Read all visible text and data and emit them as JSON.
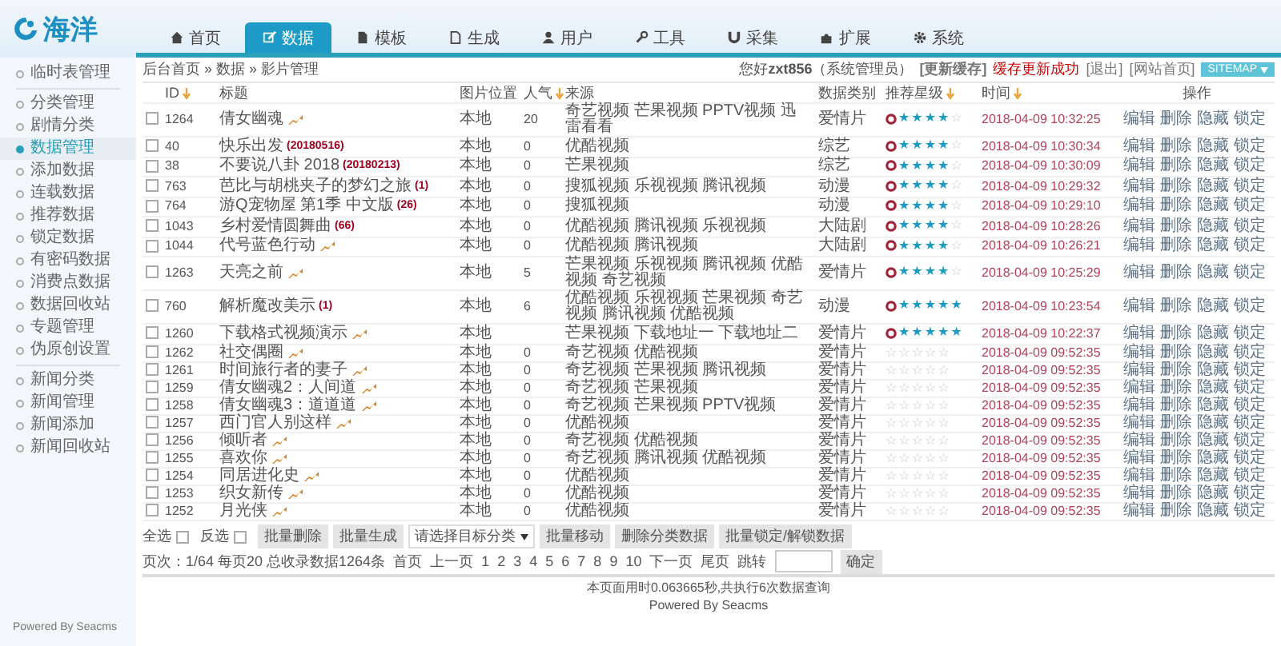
{
  "logo": {
    "text": "海洋"
  },
  "nav": [
    {
      "label": "首页",
      "selected": false
    },
    {
      "label": "数据",
      "selected": true
    },
    {
      "label": "模板",
      "selected": false
    },
    {
      "label": "生成",
      "selected": false
    },
    {
      "label": "用户",
      "selected": false
    },
    {
      "label": "工具",
      "selected": false
    },
    {
      "label": "采集",
      "selected": false
    },
    {
      "label": "扩展",
      "selected": false
    },
    {
      "label": "系统",
      "selected": false
    }
  ],
  "breadcrumb": "后台首页 » 数据 » 影片管理",
  "user_bar": {
    "greeting": "您好",
    "user": "zxt856",
    "role": "（系统管理员）",
    "refresh": "[更新缓存]",
    "status": "缓存更新成功",
    "logout": "[退出]",
    "home": "[网站首页]",
    "sitemap": "SITEMAP"
  },
  "sidebar": {
    "groups": [
      [
        {
          "label": "临时表管理",
          "selected": false
        }
      ],
      [
        {
          "label": "分类管理",
          "selected": false
        },
        {
          "label": "剧情分类",
          "selected": false
        },
        {
          "label": "数据管理",
          "selected": true
        },
        {
          "label": "添加数据",
          "selected": false
        },
        {
          "label": "连载数据",
          "selected": false
        },
        {
          "label": "推荐数据",
          "selected": false
        },
        {
          "label": "锁定数据",
          "selected": false
        },
        {
          "label": "有密码数据",
          "selected": false
        },
        {
          "label": "消费点数据",
          "selected": false
        },
        {
          "label": "数据回收站",
          "selected": false
        },
        {
          "label": "专题管理",
          "selected": false
        },
        {
          "label": "伪原创设置",
          "selected": false
        }
      ],
      [
        {
          "label": "新闻分类",
          "selected": false
        },
        {
          "label": "新闻管理",
          "selected": false
        },
        {
          "label": "新闻添加",
          "selected": false
        },
        {
          "label": "新闻回收站",
          "selected": false
        }
      ]
    ],
    "footer": "Powered By Seacms"
  },
  "table": {
    "columns": [
      {
        "label": "ID",
        "sortable": true
      },
      {
        "label": "标题",
        "sortable": false
      },
      {
        "label": "图片位置",
        "sortable": false
      },
      {
        "label": "人气",
        "sortable": true
      },
      {
        "label": "来源",
        "sortable": false
      },
      {
        "label": "数据类别",
        "sortable": false
      },
      {
        "label": "推荐星级",
        "sortable": true
      },
      {
        "label": "时间",
        "sortable": true
      },
      {
        "label": "操作",
        "sortable": false
      }
    ],
    "rows": [
      {
        "checked": false,
        "id": "1264",
        "title": "倩女幽魂",
        "hot": true,
        "image": "本地",
        "popularity": "20",
        "source": "奇艺视频 芒果视频 PPTV视频 迅雷看看",
        "category": "爱情片",
        "stars": 4,
        "time": "2018-04-09 10:32:25",
        "actions": [
          "编辑",
          "删除",
          "隐藏",
          "锁定"
        ]
      },
      {
        "checked": false,
        "id": "40",
        "title": "快乐出发",
        "note": "(20180516)",
        "hot": false,
        "image": "本地",
        "popularity": "0",
        "source": "优酷视频",
        "category": "综艺",
        "stars": 4,
        "time": "2018-04-09 10:30:34",
        "actions": [
          "编辑",
          "删除",
          "隐藏",
          "锁定"
        ]
      },
      {
        "checked": false,
        "id": "38",
        "title": "不要说八卦 2018",
        "note": "(20180213)",
        "hot": false,
        "image": "本地",
        "popularity": "0",
        "source": "芒果视频",
        "category": "综艺",
        "stars": 4,
        "time": "2018-04-09 10:30:09",
        "actions": [
          "编辑",
          "删除",
          "隐藏",
          "锁定"
        ]
      },
      {
        "checked": false,
        "id": "763",
        "title": "芭比与胡桃夹子的梦幻之旅",
        "note": "(1)",
        "hot": false,
        "image": "本地",
        "popularity": "0",
        "source": "搜狐视频 乐视视频 腾讯视频",
        "category": "动漫",
        "stars": 4,
        "time": "2018-04-09 10:29:32",
        "actions": [
          "编辑",
          "删除",
          "隐藏",
          "锁定"
        ]
      },
      {
        "checked": false,
        "id": "764",
        "title": "游Q宠物屋 第1季 中文版",
        "note": "(26)",
        "hot": false,
        "image": "本地",
        "popularity": "0",
        "source": "搜狐视频",
        "category": "动漫",
        "stars": 4,
        "time": "2018-04-09 10:29:10",
        "actions": [
          "编辑",
          "删除",
          "隐藏",
          "锁定"
        ]
      },
      {
        "checked": false,
        "id": "1043",
        "title": "乡村爱情圆舞曲",
        "note": "(66)",
        "hot": false,
        "image": "本地",
        "popularity": "0",
        "source": "优酷视频 腾讯视频 乐视视频",
        "category": "大陆剧",
        "stars": 4,
        "time": "2018-04-09 10:28:26",
        "actions": [
          "编辑",
          "删除",
          "隐藏",
          "锁定"
        ]
      },
      {
        "checked": false,
        "id": "1044",
        "title": "代号蓝色行动",
        "hot": true,
        "image": "本地",
        "popularity": "0",
        "source": "优酷视频 腾讯视频",
        "category": "大陆剧",
        "stars": 4,
        "time": "2018-04-09 10:26:21",
        "actions": [
          "编辑",
          "删除",
          "隐藏",
          "锁定"
        ]
      },
      {
        "checked": false,
        "id": "1263",
        "title": "天亮之前",
        "hot": true,
        "image": "本地",
        "popularity": "5",
        "source": "芒果视频 乐视视频 腾讯视频 优酷视频 奇艺视频",
        "category": "爱情片",
        "stars": 4,
        "time": "2018-04-09 10:25:29",
        "actions": [
          "编辑",
          "删除",
          "隐藏",
          "锁定"
        ]
      },
      {
        "checked": false,
        "id": "760",
        "title": "解析魔改美示",
        "note": "(1)",
        "hot": false,
        "image": "本地",
        "popularity": "6",
        "source": "优酷视频 乐视视频 芒果视频 奇艺视频 腾讯视频 优酷视频",
        "category": "动漫",
        "stars": 5,
        "time": "2018-04-09 10:23:54",
        "actions": [
          "编辑",
          "删除",
          "隐藏",
          "锁定"
        ]
      },
      {
        "checked": false,
        "id": "1260",
        "title": "下载格式视频演示",
        "hot": true,
        "image": "本地",
        "source": "芒果视频 下载地址一 下载地址二",
        "category": "爱情片",
        "stars": 5,
        "time": "2018-04-09 10:22:37",
        "actions": [
          "编辑",
          "删除",
          "隐藏",
          "锁定"
        ]
      },
      {
        "checked": false,
        "id": "1262",
        "title": "社交偶圈",
        "hot": true,
        "image": "本地",
        "popularity": "0",
        "source": "奇艺视频 优酷视频",
        "category": "爱情片",
        "stars": 0,
        "time": "2018-04-09 09:52:35",
        "actions": [
          "编辑",
          "删除",
          "隐藏",
          "锁定"
        ]
      },
      {
        "checked": false,
        "id": "1261",
        "title": "时间旅行者的妻子",
        "hot": true,
        "image": "本地",
        "popularity": "0",
        "source": "奇艺视频 芒果视频 腾讯视频",
        "category": "爱情片",
        "stars": 0,
        "time": "2018-04-09 09:52:35",
        "actions": [
          "编辑",
          "删除",
          "隐藏",
          "锁定"
        ]
      },
      {
        "checked": false,
        "id": "1259",
        "title": "倩女幽魂2：人间道",
        "hot": true,
        "image": "本地",
        "popularity": "0",
        "source": "奇艺视频 芒果视频",
        "category": "爱情片",
        "stars": 0,
        "time": "2018-04-09 09:52:35",
        "actions": [
          "编辑",
          "删除",
          "隐藏",
          "锁定"
        ]
      },
      {
        "checked": false,
        "id": "1258",
        "title": "倩女幽魂3：道道道",
        "hot": true,
        "image": "本地",
        "popularity": "0",
        "source": "奇艺视频 芒果视频 PPTV视频",
        "category": "爱情片",
        "stars": 0,
        "time": "2018-04-09 09:52:35",
        "actions": [
          "编辑",
          "删除",
          "隐藏",
          "锁定"
        ]
      },
      {
        "checked": false,
        "id": "1257",
        "title": "西门官人别这样",
        "hot": true,
        "image": "本地",
        "popularity": "0",
        "source": "优酷视频",
        "category": "爱情片",
        "stars": 0,
        "time": "2018-04-09 09:52:35",
        "actions": [
          "编辑",
          "删除",
          "隐藏",
          "锁定"
        ]
      },
      {
        "checked": false,
        "id": "1256",
        "title": "倾听者",
        "hot": true,
        "image": "本地",
        "popularity": "0",
        "source": "奇艺视频 优酷视频",
        "category": "爱情片",
        "stars": 0,
        "time": "2018-04-09 09:52:35",
        "actions": [
          "编辑",
          "删除",
          "隐藏",
          "锁定"
        ]
      },
      {
        "checked": false,
        "id": "1255",
        "title": "喜欢你",
        "hot": true,
        "image": "本地",
        "popularity": "0",
        "source": "奇艺视频 腾讯视频 优酷视频",
        "category": "爱情片",
        "stars": 0,
        "time": "2018-04-09 09:52:35",
        "actions": [
          "编辑",
          "删除",
          "隐藏",
          "锁定"
        ]
      },
      {
        "checked": false,
        "id": "1254",
        "title": "同居进化史",
        "hot": true,
        "image": "本地",
        "popularity": "0",
        "source": "优酷视频",
        "category": "爱情片",
        "stars": 0,
        "time": "2018-04-09 09:52:35",
        "actions": [
          "编辑",
          "删除",
          "隐藏",
          "锁定"
        ]
      },
      {
        "checked": false,
        "id": "1253",
        "title": "织女新传",
        "hot": true,
        "image": "本地",
        "popularity": "0",
        "source": "优酷视频",
        "category": "爱情片",
        "stars": 0,
        "time": "2018-04-09 09:52:35",
        "actions": [
          "编辑",
          "删除",
          "隐藏",
          "锁定"
        ]
      },
      {
        "checked": false,
        "id": "1252",
        "title": "月光侠",
        "hot": true,
        "image": "本地",
        "popularity": "0",
        "source": "优酷视频",
        "category": "爱情片",
        "stars": 0,
        "time": "2018-04-09 09:52:35",
        "actions": [
          "编辑",
          "删除",
          "隐藏",
          "锁定"
        ]
      }
    ]
  },
  "batch": [
    {
      "kind": "checkbox",
      "label": "全选",
      "checked": false
    },
    {
      "kind": "checkbox",
      "label": "反选",
      "checked": false
    },
    {
      "kind": "button",
      "label": "批量删除"
    },
    {
      "kind": "button",
      "label": "批量生成"
    },
    {
      "kind": "select",
      "label": "请选择目标分类"
    },
    {
      "kind": "button",
      "label": "批量移动"
    },
    {
      "kind": "button",
      "label": "删除分类数据"
    },
    {
      "kind": "button",
      "label": "批量锁定/解锁数据"
    }
  ],
  "pager": {
    "info": "页次：1/64 每页20 总收录数据1264条",
    "first": "首页",
    "prev": "上一页",
    "pages": [
      "1",
      "2",
      "3",
      "4",
      "5",
      "6",
      "7",
      "8",
      "9",
      "10"
    ],
    "next": "下一页",
    "last": "尾页",
    "jump_label": "跳转",
    "confirm": "确定"
  },
  "footer": {
    "stats": "本页面用时0.063665秒,共执行6次数据查询",
    "powered": "Powered By Seacms"
  }
}
